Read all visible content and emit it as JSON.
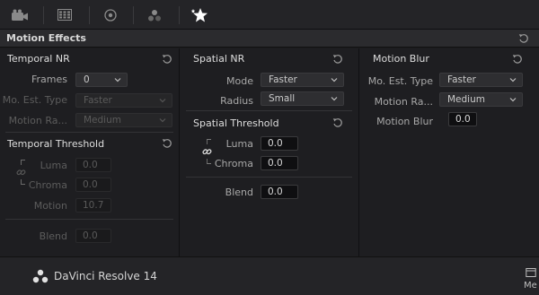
{
  "toolbar": {
    "icons": [
      "camera-icon",
      "grid-icon",
      "target-icon",
      "nodes-icon",
      "sparkle-star-icon"
    ]
  },
  "panel": {
    "title": "Motion Effects"
  },
  "temporal": {
    "title": "Temporal NR",
    "frames_label": "Frames",
    "frames_value": "0",
    "mo_est_label": "Mo. Est. Type",
    "mo_est_value": "Faster",
    "motion_range_label": "Motion Ra...",
    "motion_range_value": "Medium",
    "threshold_title": "Temporal Threshold",
    "luma_label": "Luma",
    "luma_value": "0.0",
    "chroma_label": "Chroma",
    "chroma_value": "0.0",
    "motion_label": "Motion",
    "motion_value": "10.7",
    "blend_label": "Blend",
    "blend_value": "0.0"
  },
  "spatial": {
    "title": "Spatial NR",
    "mode_label": "Mode",
    "mode_value": "Faster",
    "radius_label": "Radius",
    "radius_value": "Small",
    "threshold_title": "Spatial Threshold",
    "luma_label": "Luma",
    "luma_value": "0.0",
    "chroma_label": "Chroma",
    "chroma_value": "0.0",
    "blend_label": "Blend",
    "blend_value": "0.0"
  },
  "motion_blur": {
    "title": "Motion Blur",
    "mo_est_label": "Mo. Est. Type",
    "mo_est_value": "Faster",
    "motion_range_label": "Motion Ra...",
    "motion_range_value": "Medium",
    "motion_blur_label": "Motion Blur",
    "motion_blur_value": "0.0"
  },
  "footer": {
    "brand": "DaVinci Resolve 14",
    "right_label": "Me"
  },
  "colors": {
    "active_toolbar": "#ffffff",
    "background": "#1e1e21"
  }
}
